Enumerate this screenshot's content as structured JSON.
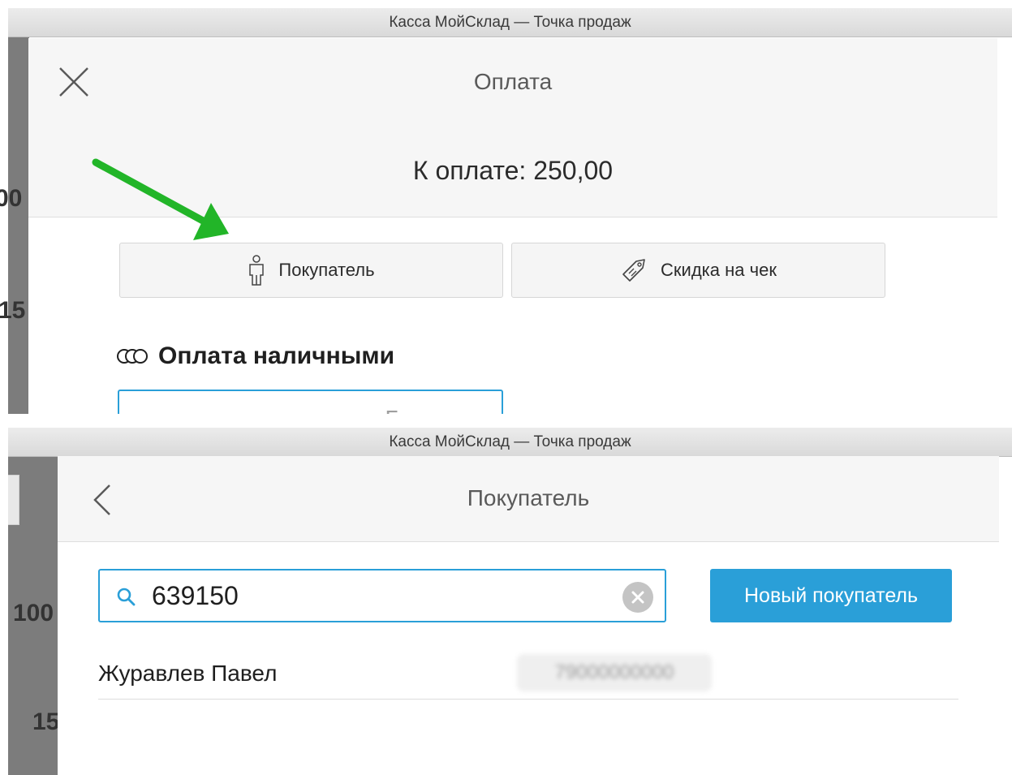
{
  "window": {
    "title": "Касса МойСклад — Точка продаж"
  },
  "background": {
    "shot1_numbers": [
      "00",
      "15"
    ],
    "shot2_numbers": [
      "100",
      "15"
    ]
  },
  "payment_modal": {
    "title": "Оплата",
    "amount_due": "К оплате: 250,00",
    "buyer_button_label": "Покупатель",
    "discount_button_label": "Скидка на чек",
    "cash_section_title": "Оплата наличными",
    "cash_input_placeholder": "Без сдачи",
    "annotation_arrow_color": "#22b528"
  },
  "buyer_modal": {
    "title": "Покупатель",
    "search": {
      "value": "639150"
    },
    "new_buyer_button_label": "Новый покупатель",
    "results": [
      {
        "name": "Журавлев Павел",
        "phone": "79000000000"
      }
    ]
  },
  "colors": {
    "accent": "#2a9fd8",
    "titlebar": "#dcdcdc",
    "header_background": "#f6f6f6",
    "app_backdrop": "#7c7c7c"
  }
}
